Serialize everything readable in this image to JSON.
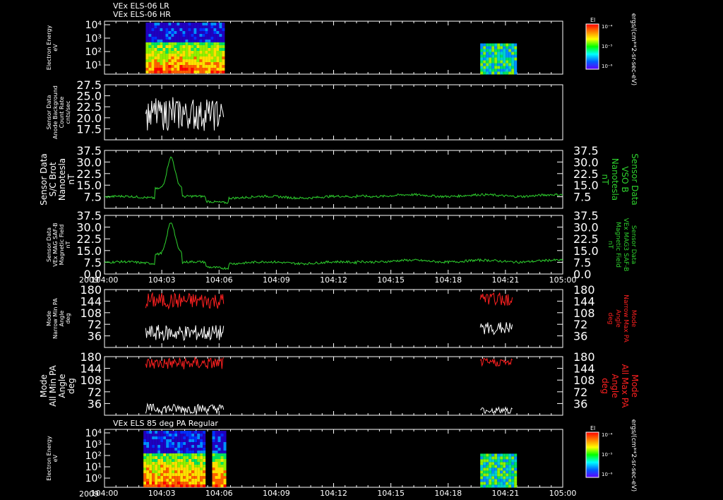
{
  "titles": {
    "top_1": "VEx ELS-06 LR",
    "top_2": "VEx ELS-06 HR",
    "bottom": "VEx ELS 85 deg PA Regular"
  },
  "time_axis": {
    "year": "2009",
    "ticks": [
      "104:00",
      "104:03",
      "104:06",
      "104:09",
      "104:12",
      "104:15",
      "104:18",
      "104:21",
      "105:00"
    ]
  },
  "colorbar": {
    "label": "El",
    "unit": "ergs/(cm**2-sr-sec-eV)",
    "tick_labels": [
      "10⁻⁴",
      "10⁻⁵",
      "10⁻⁶"
    ]
  },
  "chart_data": [
    {
      "id": "p1",
      "type": "heatmap",
      "ylabel": [
        "Electron Energy",
        "eV"
      ],
      "yscale": "log",
      "ytick_labels": [
        "10⁴",
        "10³",
        "10²",
        "10¹"
      ],
      "colorbar": true
    },
    {
      "id": "p2",
      "type": "line",
      "ylabel": [
        "Sensor Data",
        "Anode Background",
        "Count Rate",
        "cnts/sec"
      ],
      "ylim": [
        15.0,
        27.5
      ],
      "yticks": [
        17.5,
        20.0,
        22.5,
        25.0,
        27.5
      ],
      "series": [
        {
          "color": "#ffffff",
          "segments": [
            [
              0.09,
              0.26
            ]
          ]
        }
      ]
    },
    {
      "id": "p3",
      "type": "line",
      "ylabel": [
        "Sensor Data",
        "S/C Brot",
        "Nanotesla",
        "nT"
      ],
      "rlabel": [
        "Sensor Data",
        "VSO B",
        "Nanotesla",
        "nT"
      ],
      "ylim": [
        0,
        37.5
      ],
      "yticks": [
        7.5,
        15.0,
        22.5,
        30.0,
        37.5
      ],
      "series": [
        {
          "color": "#2ed22e",
          "segments": [
            [
              0.0,
              1.0
            ]
          ]
        }
      ]
    },
    {
      "id": "p4",
      "type": "line",
      "ylabel": [
        "Sensor Data",
        "VEx MAG SAF-B",
        "Magnetic Field",
        "nT"
      ],
      "rlabel": [
        "Sensor Data",
        "VEx MAG3 SAF-B",
        "Magnetic Field",
        "nT"
      ],
      "ylim": [
        0,
        37.5
      ],
      "yticks": [
        0.0,
        7.5,
        15.0,
        22.5,
        30.0,
        37.5
      ],
      "series": [
        {
          "color": "#2ed22e",
          "segments": [
            [
              0.0,
              1.0
            ]
          ]
        }
      ]
    },
    {
      "id": "p5",
      "type": "line",
      "ylabel": [
        "Mode",
        "Narrow Min PA",
        "Angle",
        "deg"
      ],
      "rlabel": [
        "Mode",
        "Narrow Max PA",
        "Angle",
        "deg"
      ],
      "ylim": [
        0,
        180
      ],
      "yticks": [
        36,
        72,
        108,
        144,
        180
      ],
      "series": [
        {
          "color": "#ffffff",
          "segments": [
            [
              0.09,
              0.26
            ],
            [
              0.82,
              0.89
            ]
          ]
        },
        {
          "color": "#ff2020",
          "segments": [
            [
              0.09,
              0.26
            ],
            [
              0.82,
              0.89
            ]
          ]
        }
      ]
    },
    {
      "id": "p6",
      "type": "line",
      "ylabel": [
        "Mode",
        "All Min PA",
        "Angle",
        "deg"
      ],
      "rlabel": [
        "Mode",
        "All Max PA",
        "Angle",
        "deg"
      ],
      "ylim": [
        0,
        180
      ],
      "yticks": [
        36,
        72,
        108,
        144,
        180
      ],
      "series": [
        {
          "color": "#ffffff",
          "segments": [
            [
              0.09,
              0.26
            ],
            [
              0.82,
              0.89
            ]
          ]
        },
        {
          "color": "#ff2020",
          "segments": [
            [
              0.09,
              0.26
            ],
            [
              0.82,
              0.89
            ]
          ]
        }
      ]
    },
    {
      "id": "p7",
      "type": "heatmap",
      "ylabel": [
        "Electron Energy",
        "eV"
      ],
      "yscale": "log",
      "ytick_labels": [
        "10⁴",
        "10³",
        "10²",
        "10¹",
        "10⁰"
      ],
      "colorbar": true
    }
  ]
}
